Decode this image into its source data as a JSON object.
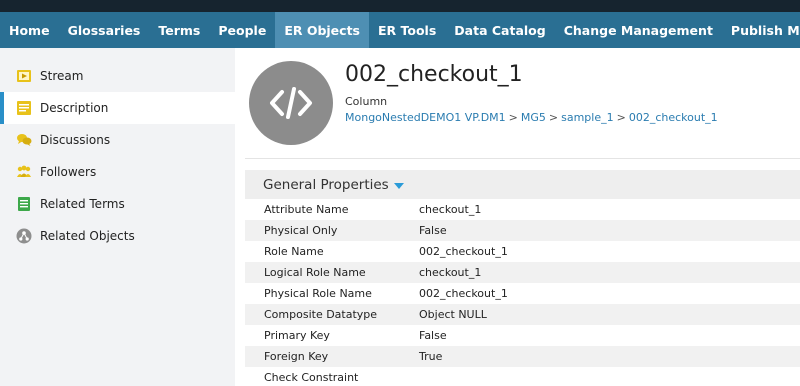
{
  "nav": {
    "items": [
      {
        "label": "Home"
      },
      {
        "label": "Glossaries"
      },
      {
        "label": "Terms"
      },
      {
        "label": "People"
      },
      {
        "label": "ER Objects"
      },
      {
        "label": "ER Tools"
      },
      {
        "label": "Data Catalog"
      },
      {
        "label": "Change Management"
      },
      {
        "label": "Publish Models"
      }
    ],
    "active_index": 4,
    "bar_color": "#2a6f93",
    "active_color": "#4e8fb3"
  },
  "sidebar": {
    "items": [
      {
        "label": "Stream",
        "icon": "stream-icon"
      },
      {
        "label": "Description",
        "icon": "description-icon"
      },
      {
        "label": "Discussions",
        "icon": "discussions-icon"
      },
      {
        "label": "Followers",
        "icon": "followers-icon"
      },
      {
        "label": "Related Terms",
        "icon": "related-terms-icon"
      },
      {
        "label": "Related Objects",
        "icon": "related-objects-icon"
      }
    ],
    "active_index": 1
  },
  "object": {
    "title": "002_checkout_1",
    "type": "Column",
    "icon": "code-icon",
    "breadcrumb": [
      "MongoNestedDEMO1 VP.DM1",
      "MG5",
      "sample_1",
      "002_checkout_1"
    ],
    "breadcrumb_separator": ">"
  },
  "general_properties": {
    "header": "General Properties",
    "rows": [
      {
        "label": "Attribute Name",
        "value": "checkout_1"
      },
      {
        "label": "Physical Only",
        "value": "False"
      },
      {
        "label": "Role Name",
        "value": "002_checkout_1"
      },
      {
        "label": "Logical Role Name",
        "value": "checkout_1"
      },
      {
        "label": "Physical Role Name",
        "value": "002_checkout_1"
      },
      {
        "label": "Composite Datatype",
        "value": "Object NULL"
      },
      {
        "label": "Primary Key",
        "value": "False"
      },
      {
        "label": "Foreign Key",
        "value": "True"
      },
      {
        "label": "Check Constraint",
        "value": ""
      }
    ]
  }
}
